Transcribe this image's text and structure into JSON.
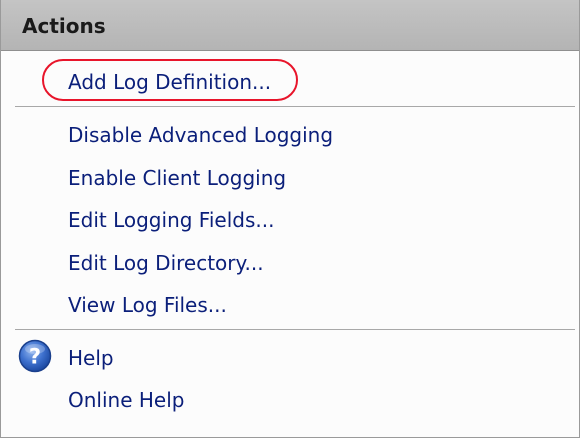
{
  "panel": {
    "title": "Actions"
  },
  "actions": {
    "group1": [
      {
        "label": "Add Log Definition..."
      }
    ],
    "group2": [
      {
        "label": "Disable Advanced Logging"
      },
      {
        "label": "Enable Client Logging"
      },
      {
        "label": "Edit Logging Fields..."
      },
      {
        "label": "Edit Log Directory..."
      },
      {
        "label": "View Log Files..."
      }
    ],
    "group3": [
      {
        "label": "Help",
        "icon": "help-icon"
      },
      {
        "label": "Online Help"
      }
    ]
  },
  "colors": {
    "header_bg": "#bcbcbc",
    "link_text": "#0b1f7a",
    "highlight_oval": "#e8142a",
    "help_icon": "#2a5db8"
  }
}
